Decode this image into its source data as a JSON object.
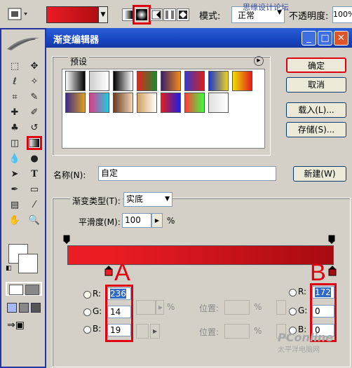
{
  "options_bar": {
    "mode_label": "模式:",
    "mode_value": "正常",
    "opacity_label": "不透明度:",
    "opacity_value": "100%",
    "gradient_colors": [
      "#ec1c24",
      "#a70b10"
    ],
    "watermark": "思缘设计论坛"
  },
  "dialog": {
    "title": "渐变编辑器",
    "presets_label": "预设",
    "buttons": {
      "ok": "确定",
      "cancel": "取消",
      "load": "载入(L)...",
      "save": "存储(S)...",
      "new": "新建(W)"
    },
    "name_label": "名称(N):",
    "name_value": "自定",
    "gradient_type_label": "渐变类型(T):",
    "gradient_type_value": "实底",
    "smoothness_label": "平滑度(M):",
    "smoothness_value": "100",
    "smoothness_unit": "%",
    "gradient_colors": [
      "#ec1c24",
      "#a70b10"
    ],
    "left_stop": {
      "r_label": "R:",
      "r": "236",
      "g_label": "G:",
      "g": "14",
      "b_label": "B:",
      "b": "19"
    },
    "right_stop": {
      "r_label": "R:",
      "r": "172",
      "g_label": "G:",
      "g": "0",
      "b_label": "B:",
      "b": "0"
    },
    "location_label": "位置:",
    "pct": "%",
    "annotation_a": "A",
    "annotation_b": "B",
    "footer_watermark": "PConline",
    "footer_watermark_sub": "太平洋电脑网"
  },
  "presets": [
    [
      "#ffffff",
      "#000000"
    ],
    [
      "#cfcfcf",
      "#ffffff"
    ],
    [
      "#000000",
      "#ffffff"
    ],
    [
      "#e0261e",
      "#1e8a2e"
    ],
    [
      "#3a1e6a",
      "#f08a1a"
    ],
    [
      "#3a3ac8",
      "#d81e1e"
    ],
    [
      "#1e3ac8",
      "#f0d21e"
    ],
    [
      "#f0e000",
      "#e01e1e"
    ],
    [
      "#3c2a8a",
      "#e0a01e"
    ],
    [
      "#e03c8a",
      "#1ecce0"
    ],
    [
      "#6a3a1e",
      "#f0d8b8"
    ],
    [
      "#d0a060",
      "#ffffff"
    ],
    [
      "#e01e1e",
      "#1e1ee0"
    ],
    [
      "#ff3c3c",
      "#3cff3c"
    ],
    [
      "#e0e0e0",
      "#ffffff"
    ]
  ]
}
